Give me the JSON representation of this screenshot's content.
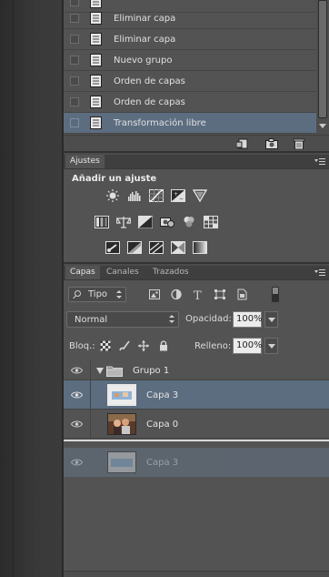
{
  "history": {
    "items": [
      {
        "label": ""
      },
      {
        "label": "Eliminar capa"
      },
      {
        "label": "Eliminar capa"
      },
      {
        "label": "Nuevo grupo"
      },
      {
        "label": "Orden de capas"
      },
      {
        "label": "Orden de capas"
      },
      {
        "label": "Transformación libre"
      }
    ],
    "active_index": 6,
    "footer_icons": [
      "new-document-from-state-icon",
      "new-snapshot-icon",
      "delete-icon"
    ]
  },
  "adjustments": {
    "tab": "Ajustes",
    "title": "Añadir un ajuste",
    "rows": [
      [
        "brightness-contrast-icon",
        "levels-icon",
        "curves-icon",
        "exposure-icon",
        "vibrance-icon"
      ],
      [
        "hue-saturation-icon",
        "color-balance-icon",
        "black-white-icon",
        "photo-filter-icon",
        "channel-mixer-icon",
        "color-lookup-icon"
      ],
      [
        "invert-icon",
        "posterize-icon",
        "threshold-icon",
        "selective-color-icon",
        "gradient-map-icon"
      ]
    ]
  },
  "layers_panel": {
    "tabs": [
      "Capas",
      "Canales",
      "Trazados"
    ],
    "active_tab": "Capas",
    "filter_type": "Tipo",
    "filter_icons": [
      "pixel-filter-icon",
      "adjustment-filter-icon",
      "type-filter-icon",
      "shape-filter-icon",
      "smart-object-filter-icon"
    ],
    "blend_mode": "Normal",
    "opacity_label": "Opacidad:",
    "opacity_value": "100%",
    "lock_label": "Bloq.:",
    "lock_icons": [
      "lock-transparency-icon",
      "lock-image-icon",
      "lock-position-icon",
      "lock-all-icon"
    ],
    "fill_label": "Relleno:",
    "fill_value": "100%",
    "layers": [
      {
        "name": "Grupo 1",
        "kind": "group"
      },
      {
        "name": "Capa 3",
        "kind": "layer",
        "selected": true
      },
      {
        "name": "Capa 0",
        "kind": "layer"
      }
    ],
    "dragging_layer": "Capa 3"
  },
  "colors": {
    "panel": "#535353",
    "selection": "#5c6d80",
    "text": "#e0e0e0"
  }
}
